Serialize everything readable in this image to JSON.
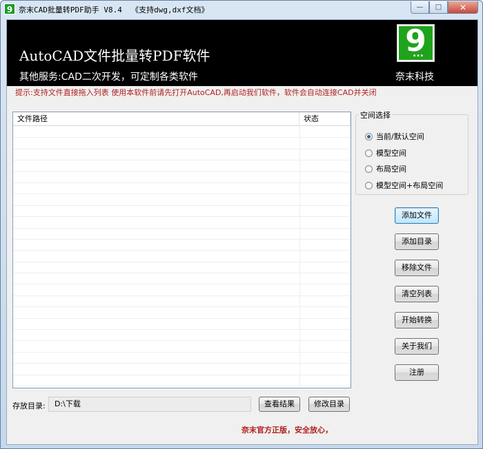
{
  "window": {
    "title": "奈末CAD批量转PDF助手 V8.4  《支持dwg,dxf文档》",
    "app_icon": "9",
    "minimize_glyph": "—",
    "maximize_glyph": "□",
    "close_glyph": "✕"
  },
  "banner": {
    "title": "AutoCAD文件批量转PDF软件",
    "subtitle": "其他服务:CAD二次开发，可定制各类软件",
    "logo_text": "9",
    "logo_dots": "...",
    "company": "奈末科技"
  },
  "tip": "提示:支持文件直接拖入列表   使用本软件前请先打开AutoCAD,再启动我们软件，软件会自动连接CAD并关闭",
  "file_list": {
    "columns": [
      "文件路径",
      "状态"
    ],
    "rows": []
  },
  "space_group": {
    "legend": "空间选择",
    "options": [
      {
        "label": "当前/默认空间",
        "checked": true
      },
      {
        "label": "模型空间",
        "checked": false
      },
      {
        "label": "布局空间",
        "checked": false
      },
      {
        "label": "模型空间+布局空间",
        "checked": false
      }
    ]
  },
  "buttons": {
    "add_file": "添加文件",
    "add_dir": "添加目录",
    "remove_file": "移除文件",
    "clear_list": "清空列表",
    "start": "开始转换",
    "about": "关于我们",
    "register": "注册"
  },
  "output": {
    "label": "存放目录:",
    "value": "D:\\下载",
    "view_results": "查看结果",
    "change_dir": "修改目录"
  },
  "footer": "奈末官方正版，安全放心，"
}
